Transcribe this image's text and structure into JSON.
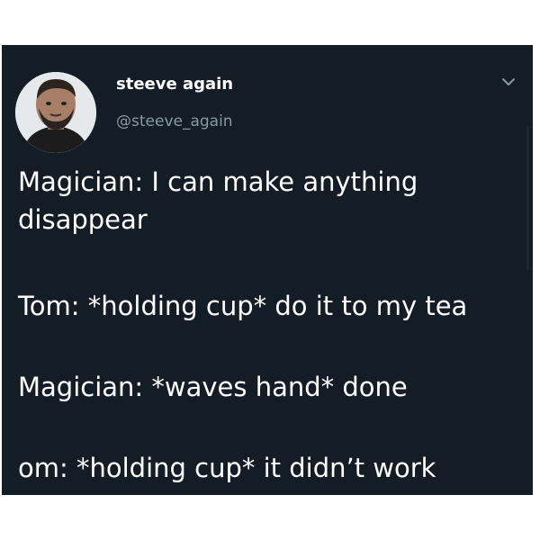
{
  "user": {
    "display_name": "steeve again",
    "handle": "@steeve_again",
    "avatar_icon": "profile-photo"
  },
  "menu_icon": "chevron-down-icon",
  "tweet": {
    "lines": [
      "Magician: I can make anything",
      "disappear",
      "Tom: *holding cup* do it to my tea",
      "Magician: *waves hand* done",
      "om: *holding cup* it didn’t work"
    ]
  },
  "colors": {
    "card_background": "#141d26",
    "primary_text": "#ffffff",
    "secondary_text": "#8899a6"
  }
}
